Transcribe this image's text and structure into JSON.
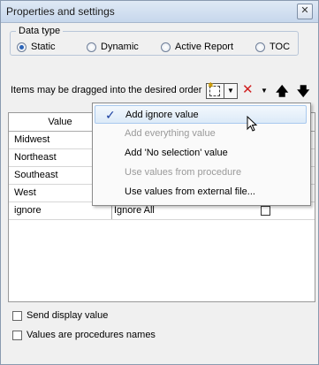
{
  "window": {
    "title": "Properties and settings",
    "close_label": "✕"
  },
  "data_type": {
    "legend": "Data type",
    "options": [
      {
        "label": "Static",
        "selected": true
      },
      {
        "label": "Dynamic",
        "selected": false
      },
      {
        "label": "Active Report",
        "selected": false
      },
      {
        "label": "TOC",
        "selected": false
      }
    ]
  },
  "toolbar": {
    "order_label": "Items may be dragged into the desired order",
    "icons": [
      "add-value-icon",
      "delete-icon",
      "move-up-icon",
      "move-down-icon"
    ],
    "delete_color": "#d02020"
  },
  "grid": {
    "columns": [
      "Value"
    ],
    "rows": [
      {
        "value": "Midwest",
        "display": ""
      },
      {
        "value": "Northeast",
        "display": ""
      },
      {
        "value": "Southeast",
        "display": ""
      },
      {
        "value": "West",
        "display": ""
      },
      {
        "value": "ignore",
        "display": "Ignore All",
        "checked": false
      }
    ]
  },
  "menu": {
    "items": [
      {
        "label": "Add ignore value",
        "enabled": true,
        "checked": true,
        "hover": true
      },
      {
        "label": "Add everything value",
        "enabled": false
      },
      {
        "label": "Add 'No selection' value",
        "enabled": true
      },
      {
        "label": "Use values from procedure",
        "enabled": false
      },
      {
        "label": "Use values from external file...",
        "enabled": true
      }
    ]
  },
  "options": {
    "send_display_value": {
      "label": "Send display value",
      "checked": false
    },
    "values_are_procedure_names": {
      "label": "Values are procedures names",
      "checked": false
    }
  }
}
